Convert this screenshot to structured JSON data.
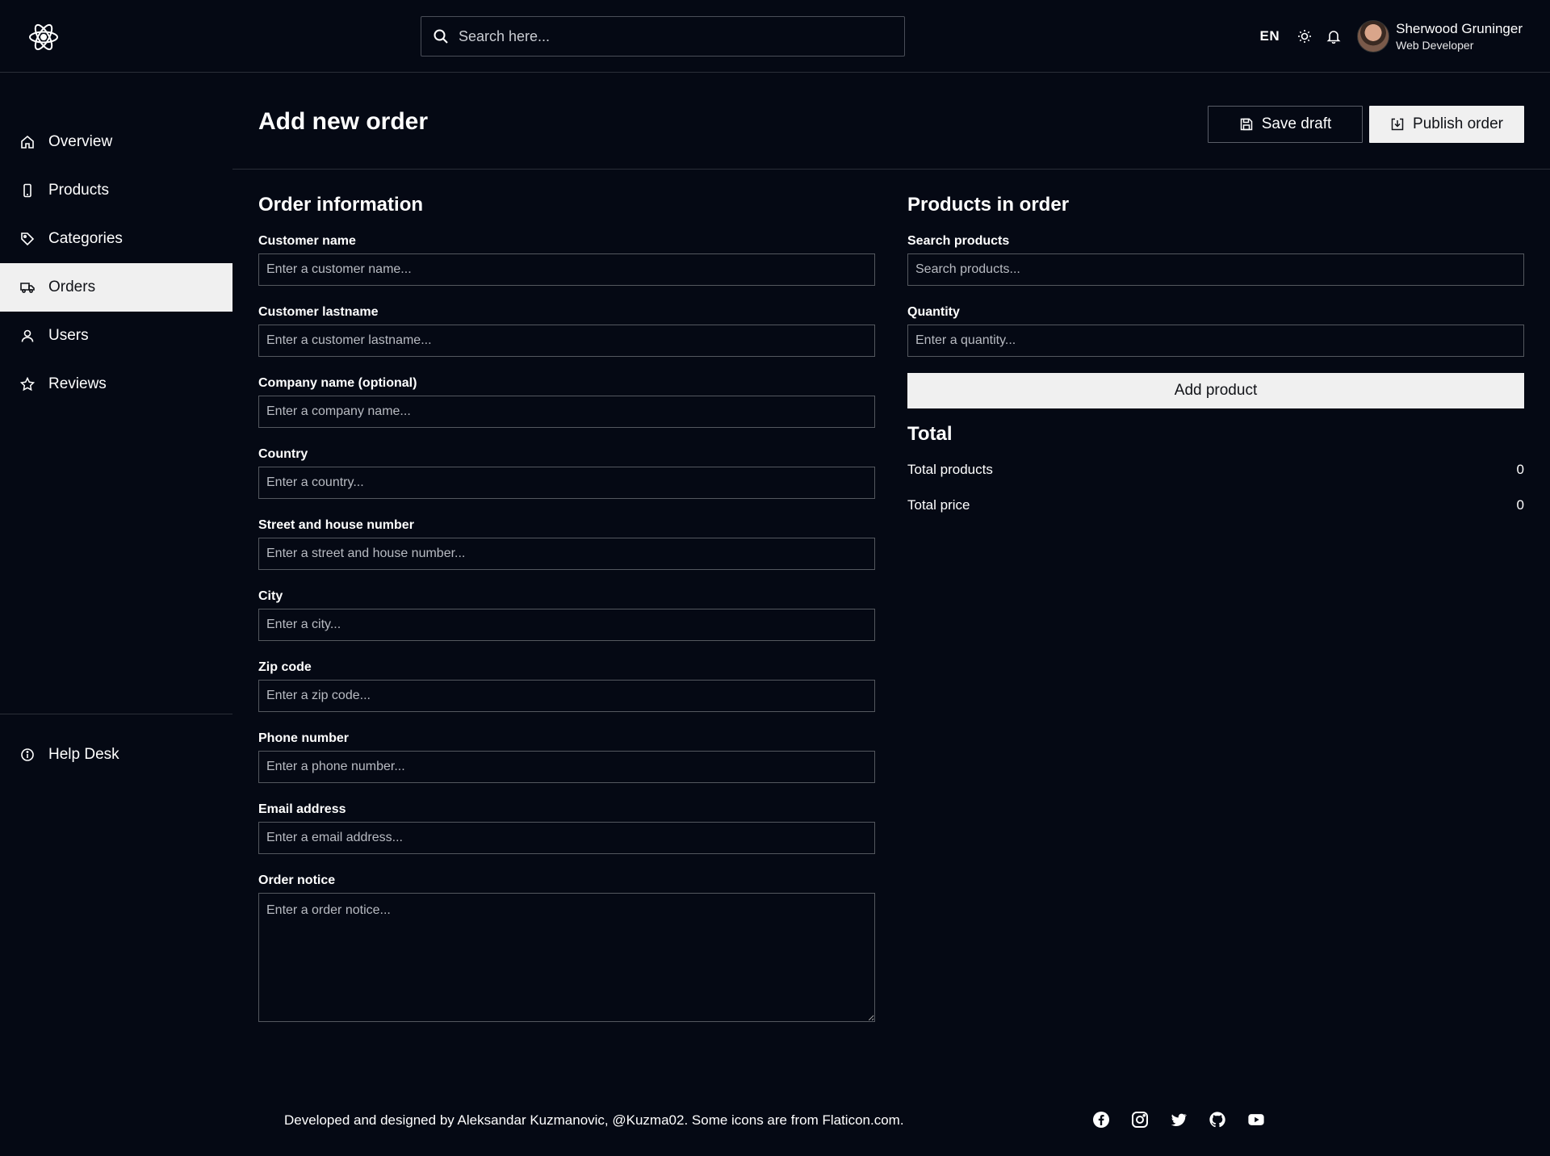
{
  "header": {
    "search_placeholder": "Search here...",
    "language": "EN",
    "user": {
      "name": "Sherwood Gruninger",
      "role": "Web Developer"
    }
  },
  "sidebar": {
    "items": [
      {
        "label": "Overview",
        "icon": "home-icon"
      },
      {
        "label": "Products",
        "icon": "phone-icon"
      },
      {
        "label": "Categories",
        "icon": "tag-icon"
      },
      {
        "label": "Orders",
        "icon": "truck-icon",
        "active": true
      },
      {
        "label": "Users",
        "icon": "user-icon"
      },
      {
        "label": "Reviews",
        "icon": "star-icon"
      }
    ],
    "help": {
      "label": "Help Desk",
      "icon": "info-icon"
    }
  },
  "page": {
    "title": "Add new order",
    "save_draft": "Save draft",
    "publish": "Publish order"
  },
  "order_info": {
    "title": "Order information",
    "fields": [
      {
        "label": "Customer name",
        "placeholder": "Enter a customer name..."
      },
      {
        "label": "Customer lastname",
        "placeholder": "Enter a customer lastname..."
      },
      {
        "label": "Company name (optional)",
        "placeholder": "Enter a company name..."
      },
      {
        "label": "Country",
        "placeholder": "Enter a country..."
      },
      {
        "label": "Street and house number",
        "placeholder": "Enter a street and house number..."
      },
      {
        "label": "City",
        "placeholder": "Enter a city..."
      },
      {
        "label": "Zip code",
        "placeholder": "Enter a zip code..."
      },
      {
        "label": "Phone number",
        "placeholder": "Enter a phone number..."
      },
      {
        "label": "Email address",
        "placeholder": "Enter a email address..."
      },
      {
        "label": "Order notice",
        "placeholder": "Enter a order notice..."
      }
    ]
  },
  "products": {
    "title": "Products in order",
    "search_label": "Search products",
    "search_placeholder": "Search products...",
    "quantity_label": "Quantity",
    "quantity_placeholder": "Enter a quantity...",
    "add_button": "Add product"
  },
  "total": {
    "title": "Total",
    "products_label": "Total products",
    "products_value": "0",
    "price_label": "Total price",
    "price_value": "0"
  },
  "footer": {
    "text": "Developed and designed by Aleksandar Kuzmanovic, @Kuzma02. Some icons are from Flaticon.com.",
    "social_icons": [
      "facebook-icon",
      "instagram-icon",
      "twitter-icon",
      "github-icon",
      "youtube-icon"
    ]
  }
}
